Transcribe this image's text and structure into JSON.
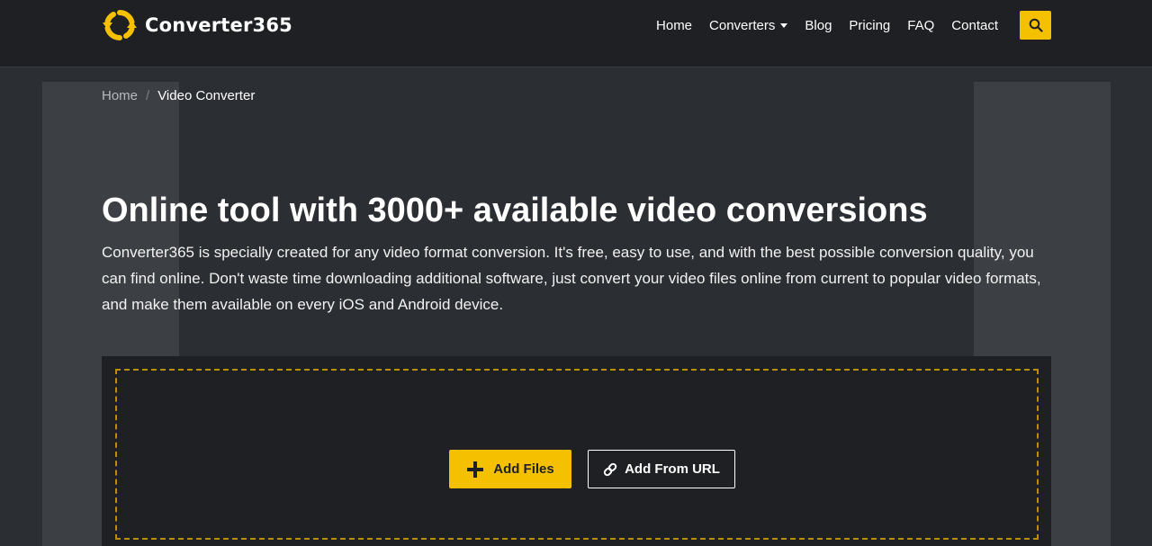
{
  "header": {
    "brand": "Converter365",
    "nav": {
      "home": "Home",
      "converters": "Converters",
      "blog": "Blog",
      "pricing": "Pricing",
      "faq": "FAQ",
      "contact": "Contact"
    },
    "search_icon": "search-icon",
    "logo_icon": "refresh-arrows-icon"
  },
  "breadcrumb": {
    "home": "Home",
    "separator": "/",
    "current": "Video Converter"
  },
  "hero": {
    "title": "Online tool with 3000+ available video conversions",
    "description": "Converter365 is specially created for any video format conversion. It's free, easy to use, and with the best possible conversion quality, you can find online. Don't waste time downloading additional software, just convert your video files online from current to popular video formats, and make them available on every iOS and Android device."
  },
  "upload": {
    "add_files": "Add Files",
    "add_url": "Add From URL",
    "add_files_icon": "plus-icon",
    "add_url_icon": "link-icon"
  },
  "colors": {
    "accent": "#f5c000",
    "header_bg": "#1e2023",
    "page_bg": "#2b2e32",
    "panel_bg": "#3c3f43"
  }
}
